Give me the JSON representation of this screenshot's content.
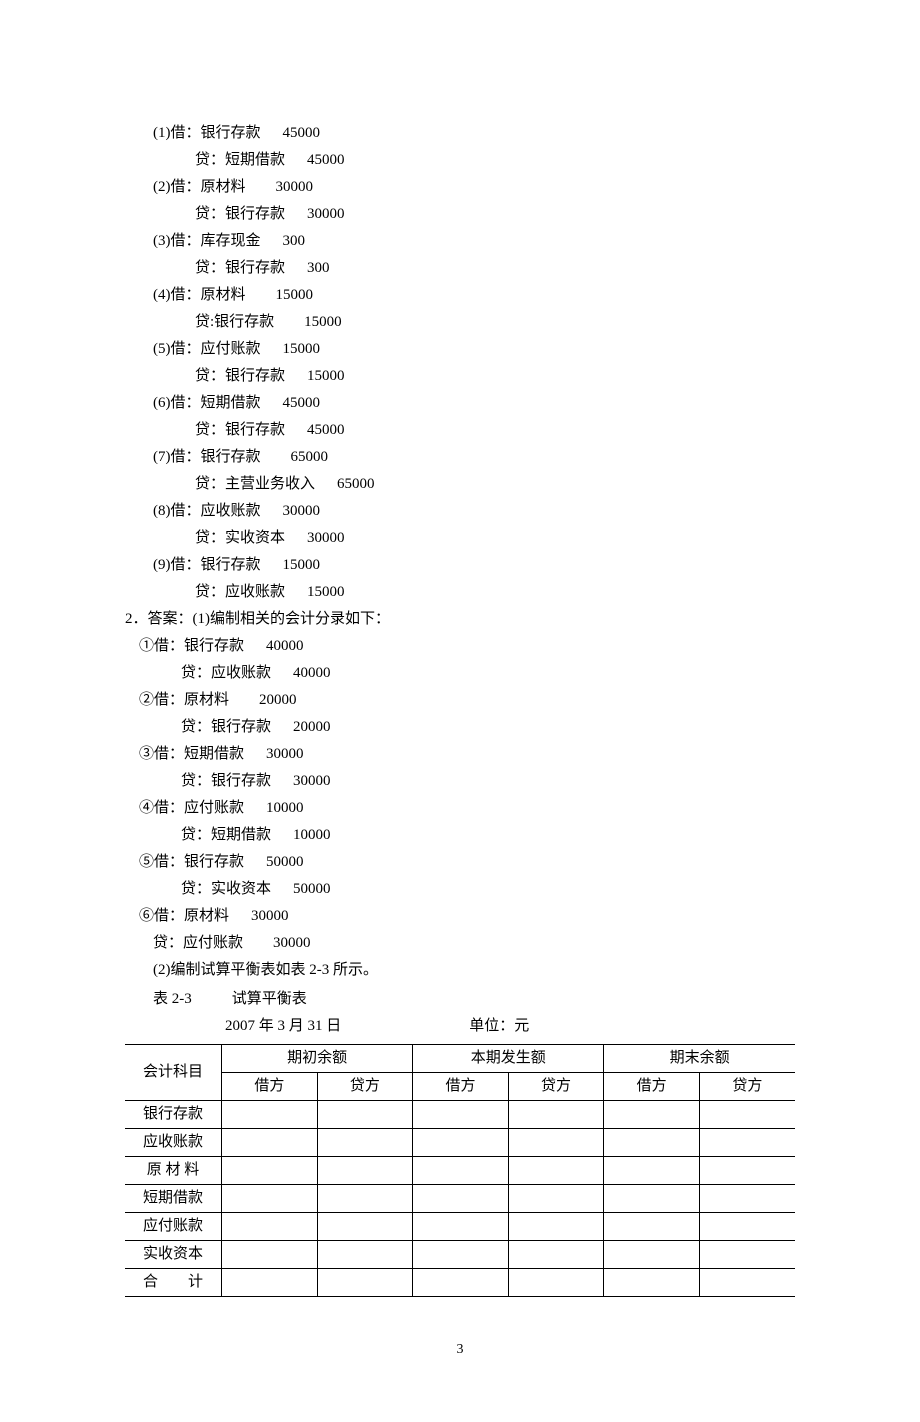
{
  "entries": [
    {
      "num": "(1)",
      "dr_label": "借：银行存款",
      "dr_amount": "45000",
      "cr_label": "贷：短期借款",
      "cr_amount": "45000"
    },
    {
      "num": "(2)",
      "dr_label": "借：原材料",
      "dr_amount": "30000",
      "cr_label": "贷：银行存款",
      "cr_amount": "30000"
    },
    {
      "num": "(3)",
      "dr_label": "借：库存现金",
      "dr_amount": "300",
      "cr_label": "贷：银行存款",
      "cr_amount": "300"
    },
    {
      "num": "(4)",
      "dr_label": "借：原材料",
      "dr_amount": "15000",
      "cr_label": "贷:银行存款",
      "cr_amount": "15000"
    },
    {
      "num": "(5)",
      "dr_label": "借：应付账款",
      "dr_amount": "15000",
      "cr_label": "贷：银行存款",
      "cr_amount": "15000"
    },
    {
      "num": "(6)",
      "dr_label": "借：短期借款",
      "dr_amount": "45000",
      "cr_label": "贷：银行存款",
      "cr_amount": "45000"
    },
    {
      "num": "(7)",
      "dr_label": "借：银行存款",
      "dr_amount": "65000",
      "cr_label": "贷：主营业务收入",
      "cr_amount": "65000"
    },
    {
      "num": "(8)",
      "dr_label": "借：应收账款",
      "dr_amount": "30000",
      "cr_label": "贷：实收资本",
      "cr_amount": "30000"
    },
    {
      "num": "(9)",
      "dr_label": "借：银行存款",
      "dr_amount": "15000",
      "cr_label": "贷：应收账款",
      "cr_amount": "15000"
    }
  ],
  "section2_intro": "2．答案：(1)编制相关的会计分录如下：",
  "sub_entries": [
    {
      "num": "①",
      "dr_label": "借：银行存款",
      "dr_amount": "40000",
      "cr_label": "贷：应收账款",
      "cr_amount": "40000"
    },
    {
      "num": "②",
      "dr_label": "借：原材料",
      "dr_amount": "20000",
      "cr_label": "贷：银行存款",
      "cr_amount": "20000"
    },
    {
      "num": "③",
      "dr_label": "借：短期借款",
      "dr_amount": "30000",
      "cr_label": "贷：银行存款",
      "cr_amount": "30000"
    },
    {
      "num": "④",
      "dr_label": "借：应付账款",
      "dr_amount": "10000",
      "cr_label": "贷：短期借款",
      "cr_amount": "10000"
    },
    {
      "num": "⑤",
      "dr_label": "借：银行存款",
      "dr_amount": "50000",
      "cr_label": "贷：实收资本",
      "cr_amount": "50000"
    },
    {
      "num": "⑥",
      "dr_label": "借：原材料",
      "dr_amount": "30000",
      "cr_label": "贷：应付账款",
      "cr_amount": "30000"
    }
  ],
  "section2_part2": "(2)编制试算平衡表如表 2-3 所示。",
  "table_label": "表 2-3",
  "table_title": "试算平衡表",
  "table_date": "2007 年 3 月  31 日",
  "table_unit": "单位：元",
  "table": {
    "col_account": "会计科目",
    "headers": [
      "期初余额",
      "本期发生额",
      "期末余额"
    ],
    "sub_headers": [
      "借方",
      "贷方",
      "借方",
      "贷方",
      "借方",
      "贷方"
    ],
    "rows": [
      "银行存款",
      "应收账款",
      "原 材 料",
      "短期借款",
      "应付账款",
      "实收资本",
      "合　　计"
    ]
  },
  "page_number": "3"
}
